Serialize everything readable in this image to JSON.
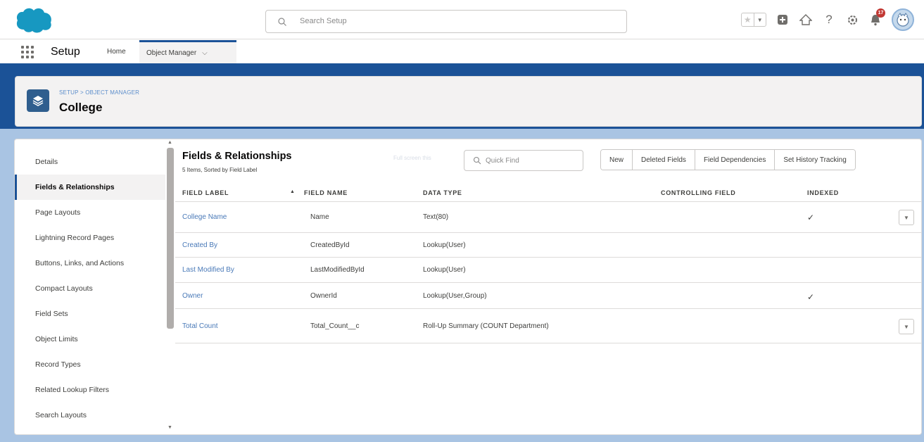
{
  "header": {
    "search_placeholder": "Search Setup",
    "notification_count": "17"
  },
  "nav": {
    "app_name": "Setup",
    "tabs": [
      {
        "label": "Home"
      },
      {
        "label": "Object Manager"
      }
    ]
  },
  "object_header": {
    "breadcrumb": "SETUP > OBJECT MANAGER",
    "title": "College"
  },
  "sidebar": {
    "items": [
      {
        "label": "Details"
      },
      {
        "label": "Fields & Relationships"
      },
      {
        "label": "Page Layouts"
      },
      {
        "label": "Lightning Record Pages"
      },
      {
        "label": "Buttons, Links, and Actions"
      },
      {
        "label": "Compact Layouts"
      },
      {
        "label": "Field Sets"
      },
      {
        "label": "Object Limits"
      },
      {
        "label": "Record Types"
      },
      {
        "label": "Related Lookup Filters"
      },
      {
        "label": "Search Layouts"
      }
    ],
    "active_index": 1
  },
  "main": {
    "title": "Fields & Relationships",
    "subtitle": "5 Items, Sorted by Field Label",
    "fullscreen_label": "Full screen this",
    "quick_find_placeholder": "Quick Find",
    "buttons": [
      {
        "label": "New"
      },
      {
        "label": "Deleted Fields"
      },
      {
        "label": "Field Dependencies"
      },
      {
        "label": "Set History Tracking"
      }
    ],
    "columns": [
      "FIELD LABEL",
      "FIELD NAME",
      "DATA TYPE",
      "CONTROLLING FIELD",
      "INDEXED"
    ],
    "rows": [
      {
        "label": "College Name",
        "name": "Name",
        "type": "Text(80)",
        "controlling": "",
        "indexed": true,
        "menu": true
      },
      {
        "label": "Created By",
        "name": "CreatedById",
        "type": "Lookup(User)",
        "controlling": "",
        "indexed": false,
        "menu": false
      },
      {
        "label": "Last Modified By",
        "name": "LastModifiedById",
        "type": "Lookup(User)",
        "controlling": "",
        "indexed": false,
        "menu": false
      },
      {
        "label": "Owner",
        "name": "OwnerId",
        "type": "Lookup(User,Group)",
        "controlling": "",
        "indexed": true,
        "menu": false
      },
      {
        "label": "Total Count",
        "name": "Total_Count__c",
        "type": "Roll-Up Summary (COUNT Department)",
        "controlling": "",
        "indexed": false,
        "menu": true
      }
    ]
  },
  "colors": {
    "brand_blue": "#1b5297",
    "link": "#4a7ab8",
    "salesforce_cloud": "#1798c1",
    "badge_red": "#c23934"
  }
}
